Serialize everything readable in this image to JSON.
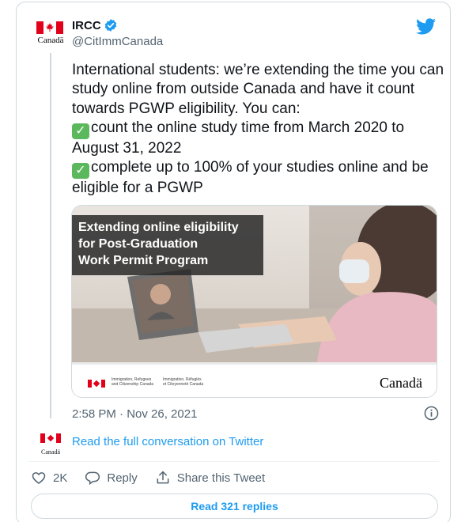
{
  "account": {
    "display_name": "IRCC",
    "handle": "@CitImmCanada",
    "avatar_wordmark": "Canadä"
  },
  "tweet": {
    "line1": "International students: we’re extending the time you can study online from outside Canada and have it count towards PGWP eligibility. You can:",
    "item1": "count the online study time from March 2020 to August 31, 2022",
    "item2": "complete up to 100% of your studies online and be eligible for a PGWP",
    "check_glyph": "✓",
    "timestamp": "2:58 PM · Nov 26, 2021"
  },
  "media": {
    "title_lines": [
      "Extending online eligibility",
      "for Post-Graduation",
      "Work Permit Program"
    ],
    "dept_en": [
      "Immigration, Refugees",
      "and Citizenship Canada"
    ],
    "dept_fr": [
      "Immigration, Réfugiés",
      "et Citoyenneté Canada"
    ],
    "wordmark": "Canadä"
  },
  "conversation": {
    "link": "Read the full conversation on Twitter",
    "avatar_wordmark": "Canadä"
  },
  "actions": {
    "likes": "2K",
    "reply": "Reply",
    "share": "Share this Tweet"
  },
  "read_replies": "Read 321 replies",
  "colors": {
    "twitter_blue": "#1d9bf0",
    "canada_red": "#e3001b",
    "muted_text": "#536471"
  },
  "icons": [
    "verified-badge-icon",
    "twitter-bird-icon",
    "info-icon",
    "heart-icon",
    "reply-bubble-icon",
    "share-icon",
    "canada-flag-icon"
  ]
}
